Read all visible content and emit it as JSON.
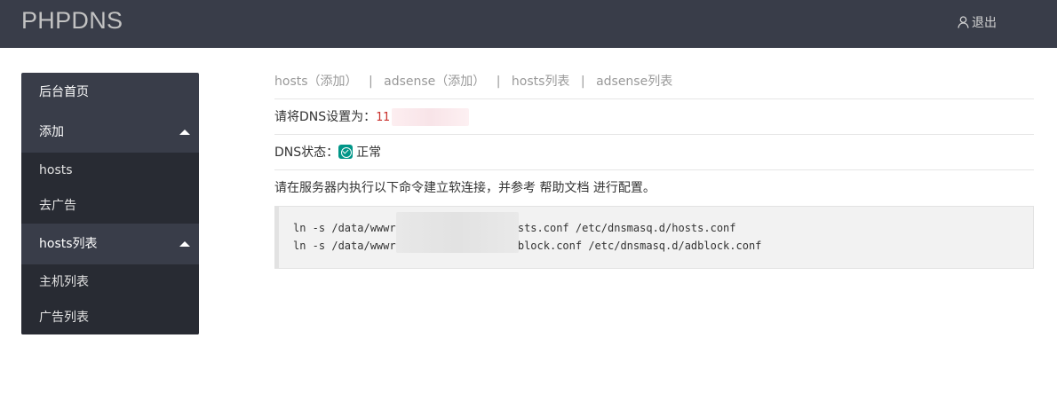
{
  "header": {
    "logo": "PHPDNS",
    "logout_label": "退出",
    "logout_icon": "user-icon"
  },
  "sidebar": {
    "items": [
      {
        "label": "后台首页"
      },
      {
        "label": "添加",
        "children": [
          {
            "label": "hosts"
          },
          {
            "label": "去广告"
          }
        ]
      },
      {
        "label": "hosts列表",
        "children": [
          {
            "label": "主机列表"
          },
          {
            "label": "广告列表"
          }
        ]
      }
    ]
  },
  "breadcrumb": {
    "items": [
      "hosts（添加）",
      "adsense（添加）",
      "hosts列表",
      "adsense列表"
    ],
    "separator": "|"
  },
  "dns_setting": {
    "label": "请将DNS设置为：",
    "value": "11"
  },
  "dns_status": {
    "label": "DNS状态：",
    "value": "正常",
    "color": "#009688"
  },
  "instruction": {
    "prefix": "请在服务器内执行以下命令建立软连接，并参考",
    "link": "帮助文档",
    "suffix": "进行配置。"
  },
  "code": {
    "lines": [
      "ln -s /data/wwwr                   pplication/conf/hosts.conf /etc/dnsmasq.d/hosts.conf",
      "ln -s /data/wwwr                   pplication/conf/adblock.conf /etc/dnsmasq.d/adblock.conf"
    ]
  },
  "colors": {
    "header_bg": "#393d49",
    "sidebar_bg": "#393d49",
    "submenu_bg": "#282b33",
    "ip_color": "#c9302c"
  }
}
